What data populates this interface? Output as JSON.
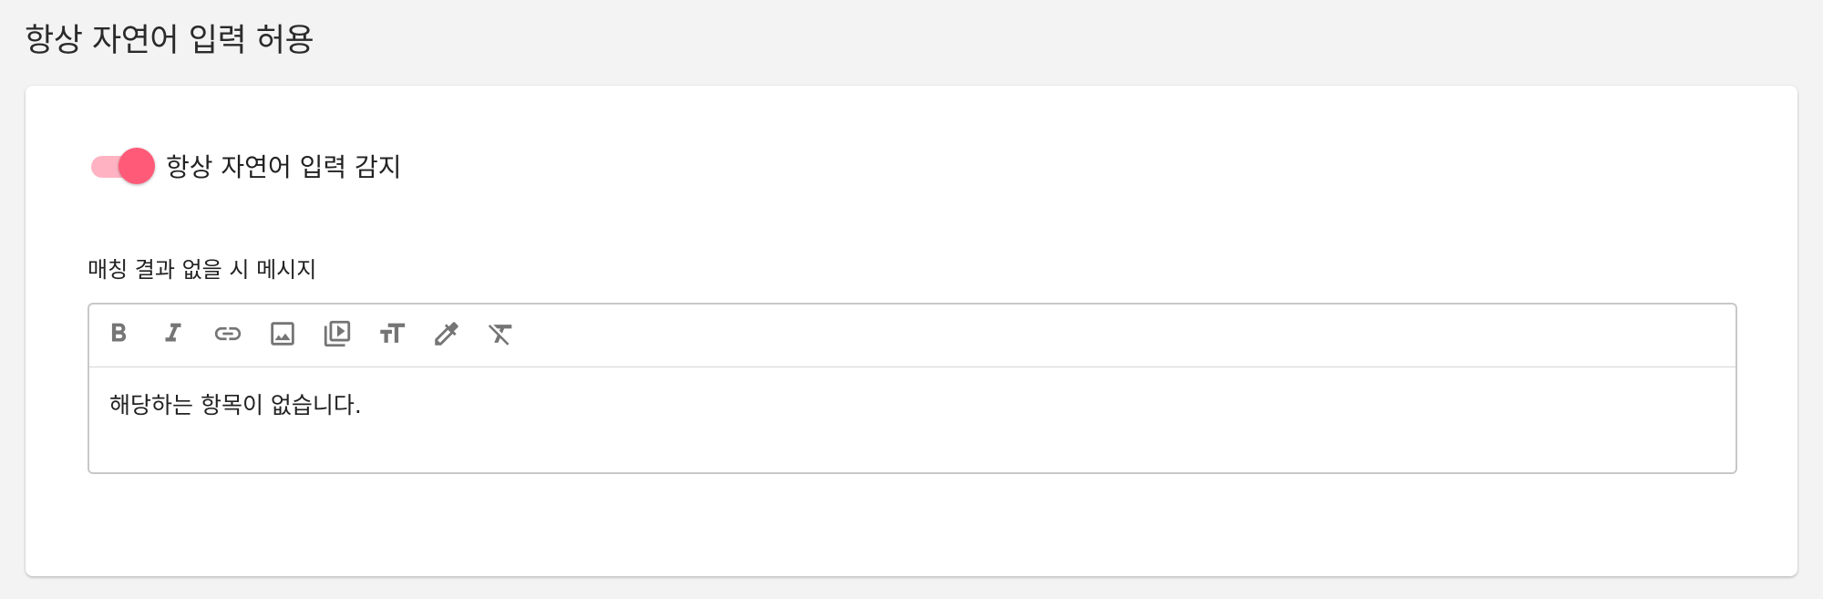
{
  "page": {
    "title": "항상 자연어 입력 허용"
  },
  "toggle": {
    "label": "항상 자연어 입력 감지",
    "checked": true,
    "track_color": "#ffb3c2",
    "thumb_color": "#ff5a78"
  },
  "editor": {
    "label": "매칭 결과 없을 시 메시지",
    "content": "해당하는 항목이 없습니다.",
    "toolbar": [
      {
        "name": "bold",
        "icon": "bold-icon"
      },
      {
        "name": "italic",
        "icon": "italic-icon"
      },
      {
        "name": "link",
        "icon": "link-icon"
      },
      {
        "name": "image",
        "icon": "image-icon"
      },
      {
        "name": "video",
        "icon": "video-library-icon"
      },
      {
        "name": "font-size",
        "icon": "text-size-icon"
      },
      {
        "name": "color",
        "icon": "eyedropper-icon"
      },
      {
        "name": "clear-format",
        "icon": "clear-format-icon"
      }
    ]
  }
}
